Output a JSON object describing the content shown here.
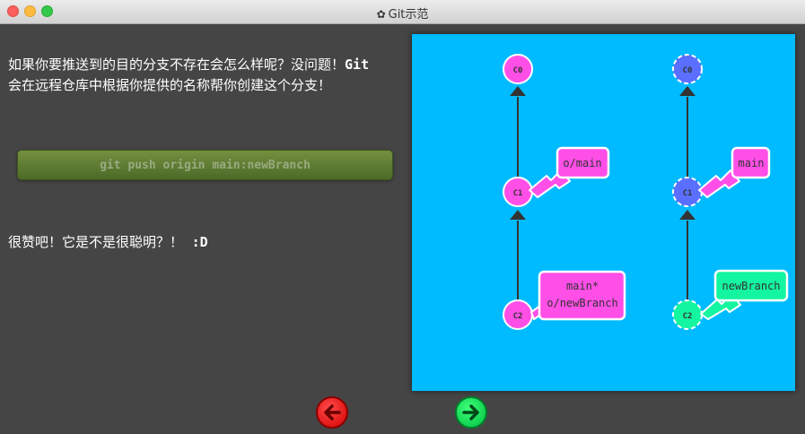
{
  "window": {
    "title": "Git示范",
    "title_icon": "gear-icon"
  },
  "dialog": {
    "paragraph1_text": "如果你要推送到的目的分支不存在会怎么样呢？没问题！",
    "paragraph1_code": "Git",
    "paragraph1_text2": "会在远程仓库中根据你提供的名称帮你创建这个分支！",
    "command": "git push origin main:newBranch",
    "paragraph3_text": "很赞吧！它是不是很聪明？！",
    "paragraph3_code": ":D"
  },
  "visualization": {
    "background": "#00bbff",
    "local": {
      "commits": [
        {
          "id": "C0",
          "color": "#ff4fe7"
        },
        {
          "id": "C1",
          "color": "#ff4fe7"
        },
        {
          "id": "C2",
          "color": "#ff4fe7"
        }
      ],
      "branches": [
        {
          "label": "o/main",
          "target": "C1",
          "color": "#ff4fe7"
        },
        {
          "label_line1": "main*",
          "label_line2": "o/newBranch",
          "target": "C2",
          "color": "#ff4fe7"
        }
      ]
    },
    "remote": {
      "commits": [
        {
          "id": "C0",
          "color": "#5a6fff"
        },
        {
          "id": "C1",
          "color": "#5a6fff"
        },
        {
          "id": "C2",
          "color": "#14f5a0"
        }
      ],
      "branches": [
        {
          "label": "main",
          "target": "C1",
          "color": "#ff4fe7"
        },
        {
          "label": "newBranch",
          "target": "C2",
          "color": "#14f5a0"
        }
      ]
    }
  },
  "navigation": {
    "prev_icon": "arrow-left-icon",
    "next_icon": "arrow-right-icon",
    "prev_color": "#e00000",
    "next_color": "#00cc44"
  }
}
